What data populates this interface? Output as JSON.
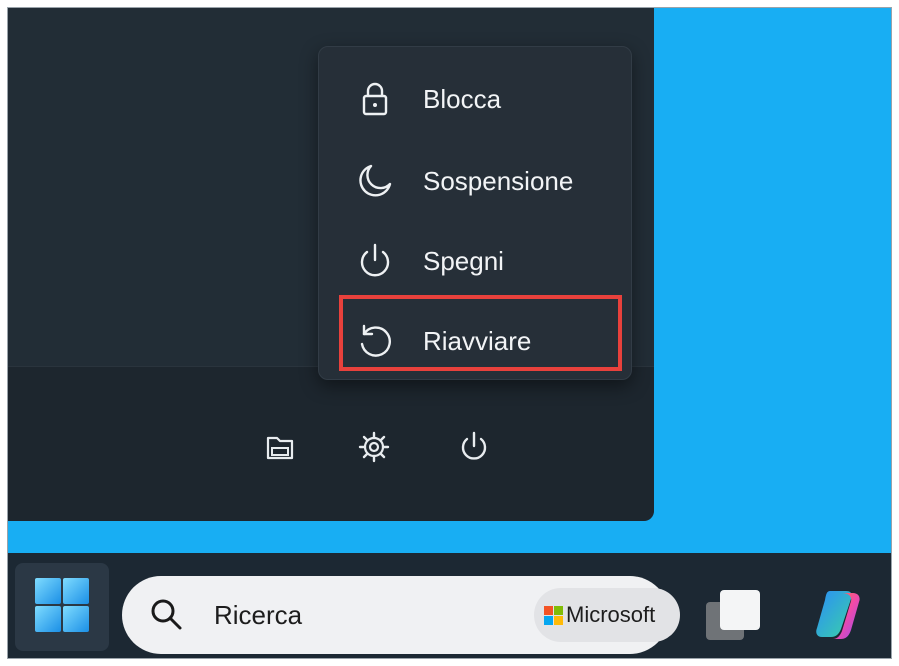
{
  "power_menu": {
    "items": [
      {
        "label": "Blocca",
        "icon": "lock-icon"
      },
      {
        "label": "Sospensione",
        "icon": "moon-icon"
      },
      {
        "label": "Spegni",
        "icon": "power-icon"
      },
      {
        "label": "Riavviare",
        "icon": "restart-icon"
      }
    ],
    "highlighted_item": "Riavviare",
    "highlight_color": "#e8413c"
  },
  "start_footer": {
    "icons": [
      "file-explorer-icon",
      "settings-gear-icon",
      "power-icon"
    ]
  },
  "taskbar": {
    "start_icon": "windows-logo-icon",
    "search": {
      "placeholder": "Ricerca",
      "badge_label": "Microsoft"
    },
    "apps": [
      "task-view-icon",
      "copilot-icon"
    ]
  },
  "colors": {
    "desktop": "#18aef3",
    "panel": "#222d36",
    "taskbar": "#1c2833",
    "menu": "#262f38"
  }
}
